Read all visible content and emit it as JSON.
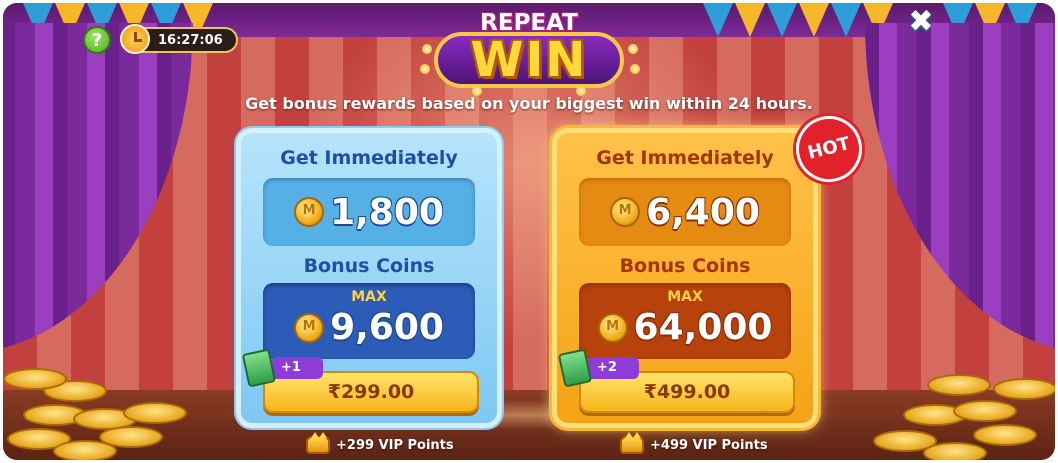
{
  "header": {
    "timer": "16:27:06",
    "help_icon": "question-icon",
    "clock_icon": "clock-icon",
    "close_icon": "close-icon"
  },
  "logo": {
    "line1": "REPEAT",
    "line2": "WIN"
  },
  "subtitle": "Get bonus rewards based on your biggest win within 24 hours.",
  "offers": [
    {
      "get_label": "Get Immediately",
      "immediate_amount": "1,800",
      "bonus_label": "Bonus Coins",
      "max_label": "MAX",
      "bonus_amount": "9,600",
      "ticket_bonus": "+1",
      "price": "₹299.00",
      "vip": "+299 VIP Points",
      "theme_color": "#7ec8f3"
    },
    {
      "get_label": "Get Immediately",
      "immediate_amount": "6,400",
      "bonus_label": "Bonus Coins",
      "max_label": "MAX",
      "bonus_amount": "64,000",
      "ticket_bonus": "+2",
      "price": "₹499.00",
      "vip": "+499 VIP Points",
      "badge": "HOT",
      "theme_color": "#f5a316"
    }
  ]
}
